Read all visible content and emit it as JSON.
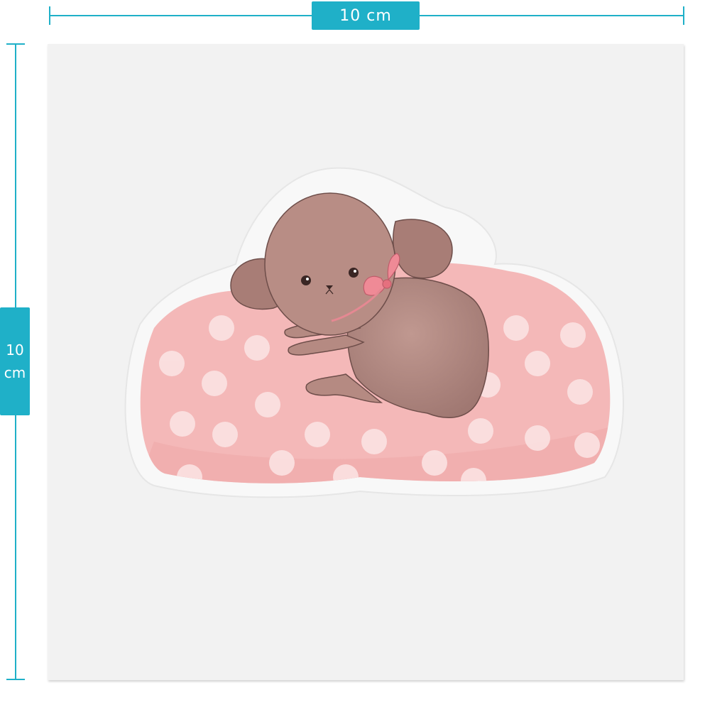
{
  "dimensions": {
    "width_label": "10 cm",
    "height_label_value": "10",
    "height_label_unit": "cm"
  },
  "colors": {
    "guide": "#1fb0c8",
    "sheet": "#f2f2f2",
    "cushion": "#f4b8b8",
    "dots": "#fbe3e3",
    "dog": "#b58a82",
    "ribbon": "#ef8a96"
  }
}
